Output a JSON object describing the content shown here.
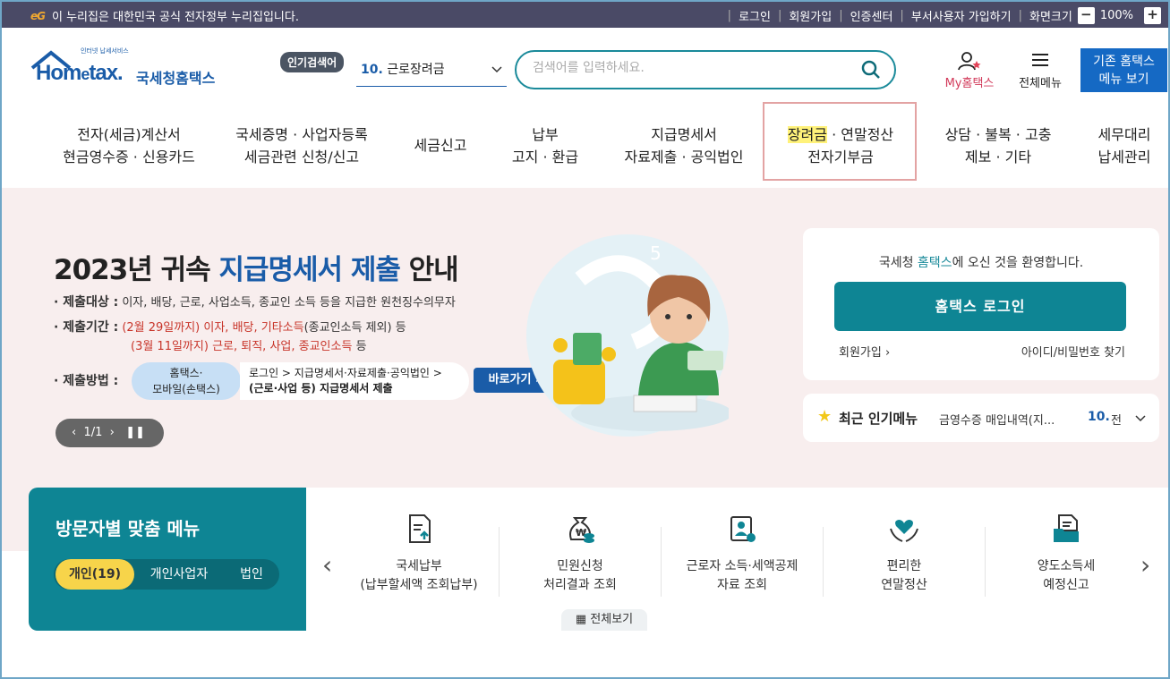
{
  "topbar": {
    "logo_text": "eG",
    "gov_notice": "이 누리집은 대한민국 공식 전자정부 누리집입니다.",
    "links": [
      "로그인",
      "회원가입",
      "인증센터",
      "부서사용자 가입하기",
      "화면크기"
    ],
    "zoom": "100%",
    "zoom_minus": "−",
    "zoom_plus": "+"
  },
  "header": {
    "logo_small": "인터넷 납세서비스",
    "logo_brand_a": "Hom",
    "logo_brand_e": "e",
    "logo_brand_b": "tax.",
    "logo_kor": "국세청홈택스",
    "popular_tag": "인기검색어",
    "popular_num": "10.",
    "popular_term": "근로장려금",
    "search_placeholder": "검색어를 입력하세요.",
    "my_hometax": "My홈택스",
    "all_menu": "전체메뉴",
    "old_home_1": "기존 홈택스",
    "old_home_2": "메뉴 보기"
  },
  "nav": [
    {
      "l1": "전자(세금)계산서",
      "l2": "현금영수증 · 신용카드"
    },
    {
      "l1": "국세증명 · 사업자등록",
      "l2": "세금관련 신청/신고"
    },
    {
      "l1": "세금신고",
      "l2": ""
    },
    {
      "l1": "납부",
      "l2": "고지 · 환급"
    },
    {
      "l1": "지급명세서",
      "l2": "자료제출 · 공익법인"
    },
    {
      "l1a": "장려금",
      "l1b": " · 연말정산",
      "l2": "전자기부금"
    },
    {
      "l1": "상담 · 불복 · 고충",
      "l2": "제보 · 기타"
    },
    {
      "l1": "세무대리",
      "l2": "납세관리"
    }
  ],
  "hero": {
    "title_a": "2023년 귀속 ",
    "title_b": "지급명세서 제출",
    "title_c": " 안내",
    "target_label": "· 제출대상 :",
    "target_text": " 이자, 배당, 근로, 사업소득, 종교인 소득 등을 지급한 원천징수의무자",
    "period_label": "· 제출기간 :",
    "period1_a": " (2월 29일까지)",
    "period1_b": " 이자, 배당, 기타소득",
    "period1_c": "(종교인소득 제외) 등",
    "period2_a": "(3월 11일까지)",
    "period2_b": " 근로, 퇴직, 사업, 종교인소득",
    "period2_c": " 등",
    "method_label": "· 제출방법 :",
    "pill_1": "홈택스·",
    "pill_2": "모바일(손택스)",
    "path_1": "로그인 > 지급명세서·자료제출·공익법인 >",
    "path_2": "(근로·사업 등) 지급명세서 제출",
    "go_button": "바로가기",
    "pager_text": "1/1"
  },
  "login": {
    "welcome_a": "국세청 ",
    "welcome_b": "홈택스",
    "welcome_c": "에 오신 것을 환영합니다.",
    "login_button": "홈택스 로그인",
    "join": "회원가입",
    "find_id": "아이디/비밀번호 찾기"
  },
  "recent": {
    "title": "최근 인기메뉴",
    "value": "금영수증 매입내역(지...",
    "num": "10.",
    "value2": "전"
  },
  "visitor": {
    "title": "방문자별 맞춤 메뉴",
    "tabs": [
      "개인(19)",
      "개인사업자",
      "법인"
    ]
  },
  "services": [
    {
      "l1": "국세납부",
      "l2": "(납부할세액 조회납부)"
    },
    {
      "l1": "민원신청",
      "l2": "처리결과 조회"
    },
    {
      "l1": "근로자 소득·세액공제",
      "l2": "자료 조회"
    },
    {
      "l1": "편리한",
      "l2": "연말정산"
    },
    {
      "l1": "양도소득세",
      "l2": "예정신고"
    }
  ],
  "view_all": "전체보기",
  "colors": {
    "teal": "#0e8594",
    "blue": "#1a5ca8",
    "topbar": "#4a4a66",
    "hero_bg": "#f8eeee",
    "highlight": "#fff27a"
  }
}
